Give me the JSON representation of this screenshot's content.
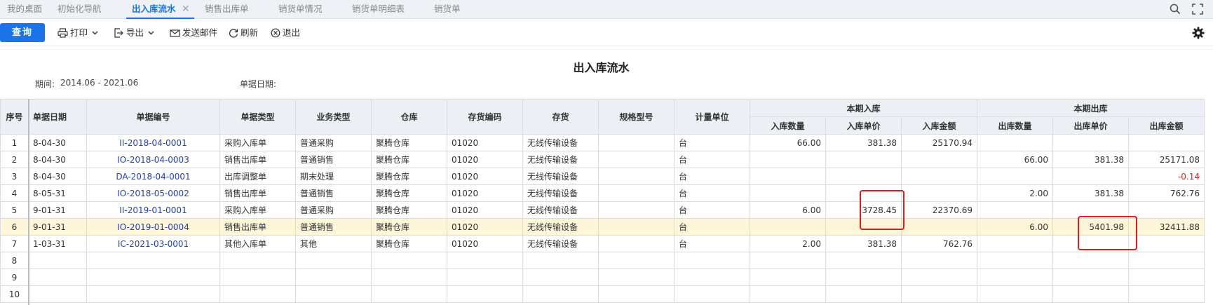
{
  "tabs": [
    {
      "label": "我的桌面",
      "active": false
    },
    {
      "label": "初始化导航",
      "active": false
    },
    {
      "label": "出入库流水",
      "active": true
    },
    {
      "label": "销售出库单",
      "active": false
    },
    {
      "label": "销货单情况",
      "active": false
    },
    {
      "label": "销货单明细表",
      "active": false
    },
    {
      "label": "销货单",
      "active": false
    }
  ],
  "tab_close_glyph": "✕",
  "toolbar": {
    "query": "查询",
    "print": "打印",
    "export": "导出",
    "send_mail": "发送邮件",
    "refresh": "刷新",
    "exit": "退出"
  },
  "report": {
    "title": "出入库流水",
    "period_label": "期间:",
    "period_value": "2014.06 - 2021.06",
    "doc_date_label": "单据日期:"
  },
  "columns": {
    "seq": "序号",
    "date": "单据日期",
    "doc_no": "单据编号",
    "doc_type": "单据类型",
    "biz_type": "业务类型",
    "warehouse": "仓库",
    "item_code": "存货编码",
    "item": "存货",
    "spec": "规格型号",
    "unit": "计量单位",
    "in_group": "本期入库",
    "in_qty": "入库数量",
    "in_price": "入库单价",
    "in_amount": "入库金额",
    "out_group": "本期出库",
    "out_qty": "出库数量",
    "out_price": "出库单价",
    "out_amount": "出库金额"
  },
  "rows": [
    {
      "seq": "1",
      "date": "8-04-30",
      "doc_no": "II-2018-04-0001",
      "doc_type": "采购入库单",
      "biz_type": "普通采购",
      "warehouse": "聚腾仓库",
      "item_code": "01020",
      "item": "无线传输设备",
      "spec": "",
      "unit": "台",
      "in_qty": "66.00",
      "in_price": "381.38",
      "in_amount": "25170.94",
      "out_qty": "",
      "out_price": "",
      "out_amount": ""
    },
    {
      "seq": "2",
      "date": "8-04-30",
      "doc_no": "IO-2018-04-0003",
      "doc_type": "销售出库单",
      "biz_type": "普通销售",
      "warehouse": "聚腾仓库",
      "item_code": "01020",
      "item": "无线传输设备",
      "spec": "",
      "unit": "台",
      "in_qty": "",
      "in_price": "",
      "in_amount": "",
      "out_qty": "66.00",
      "out_price": "381.38",
      "out_amount": "25171.08"
    },
    {
      "seq": "3",
      "date": "8-04-30",
      "doc_no": "DA-2018-04-0001",
      "doc_type": "出库调整单",
      "biz_type": "期末处理",
      "warehouse": "聚腾仓库",
      "item_code": "01020",
      "item": "无线传输设备",
      "spec": "",
      "unit": "台",
      "in_qty": "",
      "in_price": "",
      "in_amount": "",
      "out_qty": "",
      "out_price": "",
      "out_amount": "-0.14"
    },
    {
      "seq": "4",
      "date": "8-05-31",
      "doc_no": "IO-2018-05-0002",
      "doc_type": "销售出库单",
      "biz_type": "普通销售",
      "warehouse": "聚腾仓库",
      "item_code": "01020",
      "item": "无线传输设备",
      "spec": "",
      "unit": "台",
      "in_qty": "",
      "in_price": "",
      "in_amount": "",
      "out_qty": "2.00",
      "out_price": "381.38",
      "out_amount": "762.76"
    },
    {
      "seq": "5",
      "date": "9-01-31",
      "doc_no": "II-2019-01-0001",
      "doc_type": "采购入库单",
      "biz_type": "普通采购",
      "warehouse": "聚腾仓库",
      "item_code": "01020",
      "item": "无线传输设备",
      "spec": "",
      "unit": "台",
      "in_qty": "6.00",
      "in_price": "3728.45",
      "in_amount": "22370.69",
      "out_qty": "",
      "out_price": "",
      "out_amount": ""
    },
    {
      "seq": "6",
      "date": "9-01-31",
      "doc_no": "IO-2019-01-0004",
      "doc_type": "销售出库单",
      "biz_type": "普通销售",
      "warehouse": "聚腾仓库",
      "item_code": "01020",
      "item": "无线传输设备",
      "spec": "",
      "unit": "台",
      "in_qty": "",
      "in_price": "",
      "in_amount": "",
      "out_qty": "6.00",
      "out_price": "5401.98",
      "out_amount": "32411.88",
      "selected": true
    },
    {
      "seq": "7",
      "date": "1-03-31",
      "doc_no": "IC-2021-03-0001",
      "doc_type": "其他入库单",
      "biz_type": "其他",
      "warehouse": "聚腾仓库",
      "item_code": "01020",
      "item": "无线传输设备",
      "spec": "",
      "unit": "台",
      "in_qty": "2.00",
      "in_price": "381.38",
      "in_amount": "762.76",
      "out_qty": "",
      "out_price": "",
      "out_amount": ""
    },
    {
      "seq": "8",
      "date": "",
      "doc_no": "",
      "doc_type": "",
      "biz_type": "",
      "warehouse": "",
      "item_code": "",
      "item": "",
      "spec": "",
      "unit": "",
      "in_qty": "",
      "in_price": "",
      "in_amount": "",
      "out_qty": "",
      "out_price": "",
      "out_amount": ""
    },
    {
      "seq": "9",
      "date": "",
      "doc_no": "",
      "doc_type": "",
      "biz_type": "",
      "warehouse": "",
      "item_code": "",
      "item": "",
      "spec": "",
      "unit": "",
      "in_qty": "",
      "in_price": "",
      "in_amount": "",
      "out_qty": "",
      "out_price": "",
      "out_amount": ""
    },
    {
      "seq": "10",
      "date": "",
      "doc_no": "",
      "doc_type": "",
      "biz_type": "",
      "warehouse": "",
      "item_code": "",
      "item": "",
      "spec": "",
      "unit": "",
      "in_qty": "",
      "in_price": "",
      "in_amount": "",
      "out_qty": "",
      "out_price": "",
      "out_amount": ""
    }
  ],
  "colors": {
    "accent": "#1a73e8",
    "highlight": "#e51a1a",
    "selected_row": "#fdf6d8",
    "link": "#1f3fbf",
    "negative": "#e02020"
  }
}
